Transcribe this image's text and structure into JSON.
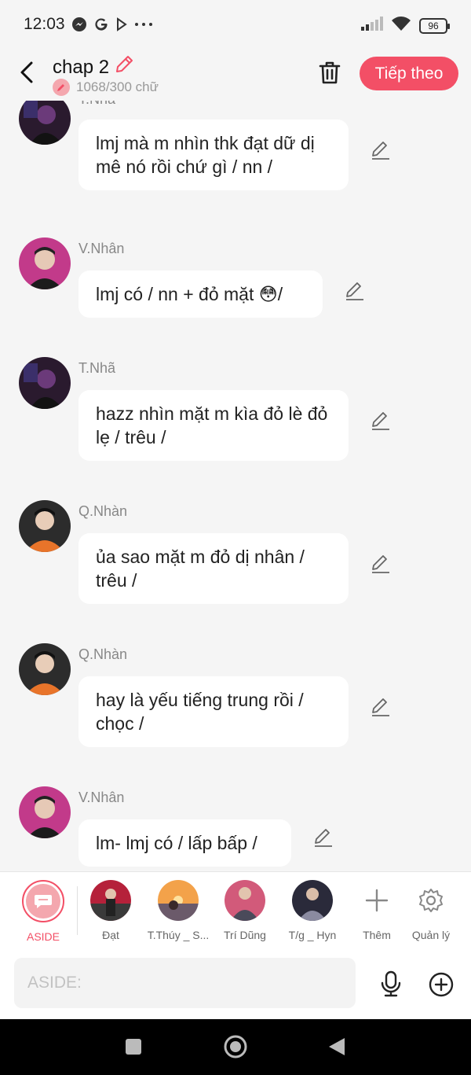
{
  "status_bar": {
    "time": "12:03",
    "icons": [
      "messenger-icon",
      "google-icon",
      "play-icon",
      "more-dots-icon"
    ],
    "battery": "96"
  },
  "header": {
    "title": "chap 2",
    "word_count": "1068/300 chữ",
    "next_label": "Tiếp theo"
  },
  "messages": [
    {
      "name": "T.Nhã",
      "text": "lmj mà m nhìn thk đạt dữ dị mê nó rồi chứ gì / nn /",
      "avatar_colors": [
        "#2a1a2e",
        "#6b3a7a"
      ]
    },
    {
      "name": "V.Nhân",
      "text": "lmj có / nn + đỏ mặt 😳/",
      "avatar_colors": [
        "#c23a8a",
        "#1c1c1c"
      ]
    },
    {
      "name": "T.Nhã",
      "text": "hazz nhìn mặt m kìa đỏ lè đỏ lẹ / trêu /",
      "avatar_colors": [
        "#2a1a2e",
        "#6b3a7a"
      ]
    },
    {
      "name": "Q.Nhàn",
      "text": "ủa sao mặt m đỏ dị nhân / trêu /",
      "avatar_colors": [
        "#e8742a",
        "#2c2c2c"
      ]
    },
    {
      "name": "Q.Nhàn",
      "text": "hay là yếu tiếng trung rồi / chọc /",
      "avatar_colors": [
        "#e8742a",
        "#2c2c2c"
      ]
    },
    {
      "name": "V.Nhân",
      "text": "lm- lmj có / lấp bấp /",
      "avatar_colors": [
        "#c23a8a",
        "#1c1c1c"
      ]
    }
  ],
  "characters": [
    {
      "label": "ASIDE",
      "type": "aside"
    },
    {
      "label": "Đạt",
      "colors": [
        "#3a3a3a",
        "#b5213a"
      ]
    },
    {
      "label": "T.Thúy _ S...",
      "colors": [
        "#f3a24a",
        "#6b5a6a"
      ]
    },
    {
      "label": "Trí Dũng",
      "colors": [
        "#4a4a5a",
        "#d25a7a"
      ]
    },
    {
      "label": "T/g _ Hyn",
      "colors": [
        "#2a2a3a",
        "#8a8aa0"
      ]
    },
    {
      "label": "Thêm",
      "type": "add"
    },
    {
      "label": "Quản lý",
      "type": "settings"
    }
  ],
  "input": {
    "placeholder": "ASIDE:"
  },
  "colors": {
    "accent": "#f34f66",
    "accent_light": "#f4a7ae",
    "background": "#f5f5f5"
  }
}
